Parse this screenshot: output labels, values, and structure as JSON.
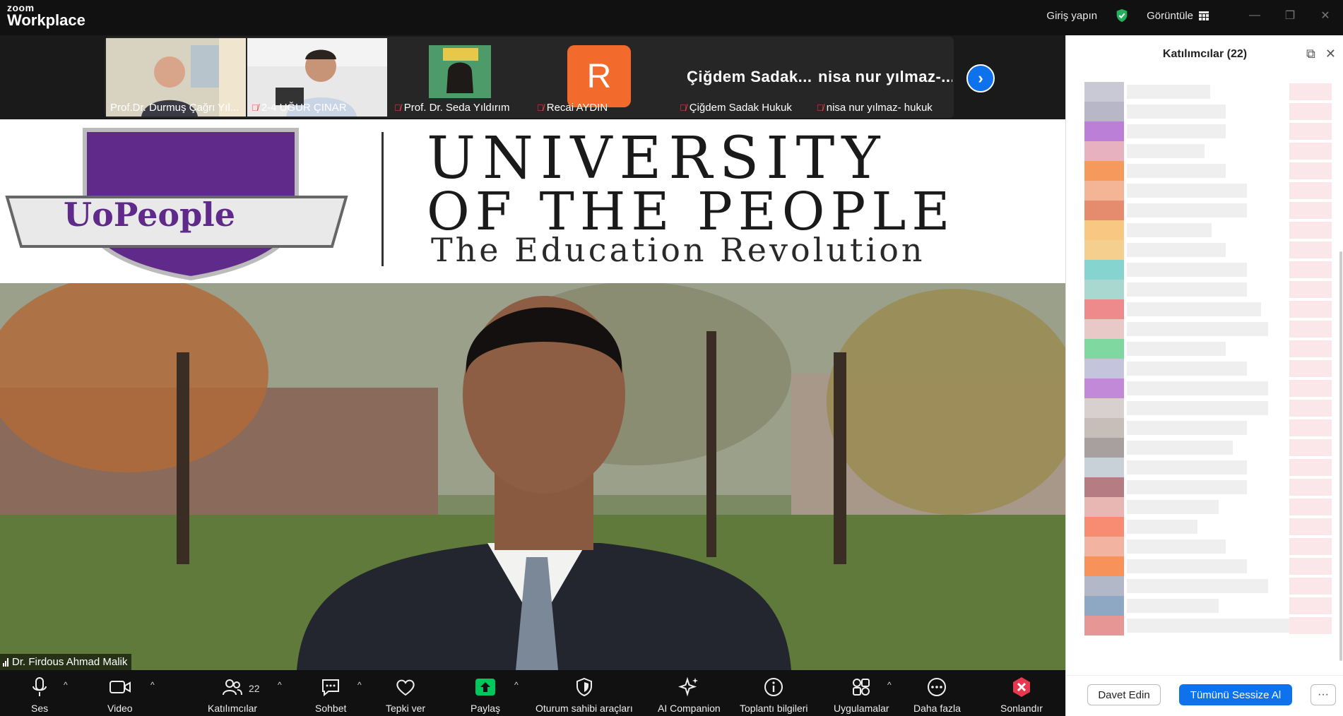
{
  "titlebar": {
    "logo_small": "zoom",
    "logo_big": "Workplace",
    "signin": "Giriş yapın",
    "view": "Görüntüle"
  },
  "thumbnails": [
    {
      "name": "Prof.Dr. Durmuş Çağrı Yıl...",
      "muted": false
    },
    {
      "name": "2-4 UĞUR ÇINAR",
      "muted": true
    },
    {
      "name": "Prof. Dr. Seda Yıldırım",
      "muted": true
    },
    {
      "name": "Recai AYDIN",
      "muted": true,
      "avatar_letter": "R",
      "avatar_color": "#f26a2c"
    },
    {
      "name": "Çiğdem Sadak Hukuk",
      "muted": true,
      "big_name": "Çiğdem Sadak..."
    },
    {
      "name": "nisa nur yılmaz- hukuk",
      "muted": true,
      "big_name": "nisa nur yılmaz-..."
    }
  ],
  "main": {
    "banner_logo_text": "UoPeople",
    "banner_title": "UNIVERSITY",
    "banner_sub1": "OF THE PEOPLE",
    "banner_sub2": "The Education Revolution",
    "speaker": "Dr. Firdous Ahmad Malik"
  },
  "panel": {
    "title": "Katılımcılar (22)",
    "invite": "Davet Edin",
    "mute_all": "Tümünü Sessize Al",
    "more": "···",
    "avatar_colors": [
      "#c9c9d6",
      "#b7b7c8",
      "#bb7fd8",
      "#e7b1c0",
      "#f59a5c",
      "#f3b595",
      "#e58c6f",
      "#f8c882",
      "#f5cf8e",
      "#85d4cf",
      "#a8d8cf",
      "#ef8a8c",
      "#e9c8c8",
      "#7fd8a0",
      "#c4c4dc",
      "#c389d9",
      "#d8cfcf",
      "#c7bdb9",
      "#a8a09e",
      "#c8d0d8",
      "#b57d83",
      "#e8b7b3",
      "#f88c73",
      "#f2b4a0",
      "#f7935a",
      "#b3b8c8",
      "#8ea7c2",
      "#e79696"
    ]
  },
  "toolbar": {
    "items": [
      {
        "label": "Ses"
      },
      {
        "label": "Video"
      },
      {
        "label": "Katılımcılar",
        "count": "22"
      },
      {
        "label": "Sohbet"
      },
      {
        "label": "Tepki ver"
      },
      {
        "label": "Paylaş"
      },
      {
        "label": "Oturum sahibi araçları"
      },
      {
        "label": "AI Companion"
      },
      {
        "label": "Toplantı bilgileri"
      },
      {
        "label": "Uygulamalar"
      },
      {
        "label": "Daha fazla"
      },
      {
        "label": "Sonlandır"
      }
    ],
    "accent": "#0e72ed",
    "share_color": "#00c65e",
    "end_color": "#e8384f"
  }
}
